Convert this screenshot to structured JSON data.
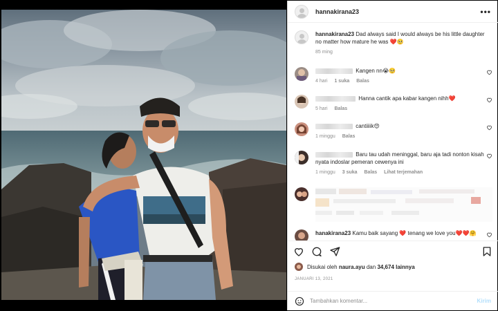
{
  "post": {
    "username": "hannakirana23",
    "more_label": "•••",
    "caption": {
      "username": "hannakirana23",
      "text": "Dad always said I would always be his little daughter no matter how mature he was ❤️🥺",
      "time": "85 ming"
    },
    "comments": [
      {
        "text": "Kangen nn😭🥺",
        "time": "4 hari",
        "likes": "1 suka",
        "reply": "Balas"
      },
      {
        "text": "Hanna cantik apa kabar kangen nihh❤️",
        "time": "5 hari",
        "reply": "Balas"
      },
      {
        "text": "cantiiiik😍",
        "time": "1 minggu",
        "reply": "Balas"
      },
      {
        "text": "Baru tau udah meninggal, baru aja tadi nonton kisah nyata indoslar pemeran cewenya ini",
        "time": "1 minggu",
        "likes": "3 suka",
        "reply": "Balas",
        "translate": "Lihat terjemahan"
      },
      {
        "username": "hanakirana23",
        "text": "Kamu baik sayang ❤️ tenang we love you❤️❤️🤗"
      }
    ],
    "liked_by_prefix": "Disukai oleh",
    "liked_by_user": "naura.ayu",
    "liked_by_conj": "dan",
    "liked_by_count": "34,674 lainnya",
    "date": "JANUARI 13, 2021",
    "comment_placeholder": "Tambahkan komentar...",
    "post_button": "Kirim"
  },
  "icons": {
    "like": "heart-icon",
    "comment": "comment-icon",
    "share": "share-icon",
    "save": "bookmark-icon",
    "emoji": "emoji-icon"
  },
  "colors": {
    "heart_red": "#d52b3a",
    "post_button_disabled": "#b2dffc",
    "muted_text": "#8e8e8e"
  }
}
